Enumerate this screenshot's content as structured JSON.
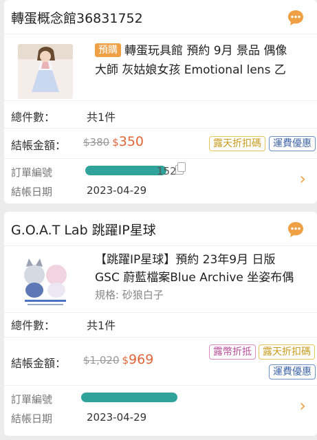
{
  "orders": [
    {
      "shop_name": "轉蛋概念館36831752",
      "product": {
        "tag": "預購",
        "title_line1": "轉蛋玩具館 預約 9月 景品 偶像",
        "title_line2": "大師 灰姑娘女孩 Emotional lens 乙",
        "spec": ""
      },
      "total_count_label": "總件數：",
      "total_count_value": "共1件",
      "checkout_label": "結帳金額：",
      "original_price": "$380",
      "currency": "$",
      "final_price": "350",
      "badges": [
        "露天折扣碼",
        "運費優惠"
      ],
      "order_no_label": "訂單編號",
      "order_no_visible": "152",
      "date_label": "結帳日期",
      "date_value": "2023-04-29"
    },
    {
      "shop_name": "G.O.A.T Lab 跳躍IP星球",
      "product": {
        "tag": "",
        "title_line1": "【跳躍IP星球】預約 23年9月 日版",
        "title_line2": "GSC 蔚藍檔案Blue Archive 坐姿布偶",
        "spec": "規格: 砂狼白子"
      },
      "total_count_label": "總件數：",
      "total_count_value": "共1件",
      "checkout_label": "結帳金額：",
      "original_price": "$1,020",
      "currency": "$",
      "final_price": "969",
      "badges": [
        "露幣折抵",
        "露天折扣碼",
        "運費優惠"
      ],
      "order_no_label": "訂單編號",
      "order_no_visible": "",
      "date_label": "結帳日期",
      "date_value": "2023-04-29"
    }
  ],
  "icons": {
    "chat": "chat-bubble-icon",
    "copy": "copy-icon",
    "chevron": "chevron-right-icon"
  },
  "colors": {
    "accent": "#f0a044",
    "price": "#e4643a",
    "redaction": "#2fa39a"
  }
}
